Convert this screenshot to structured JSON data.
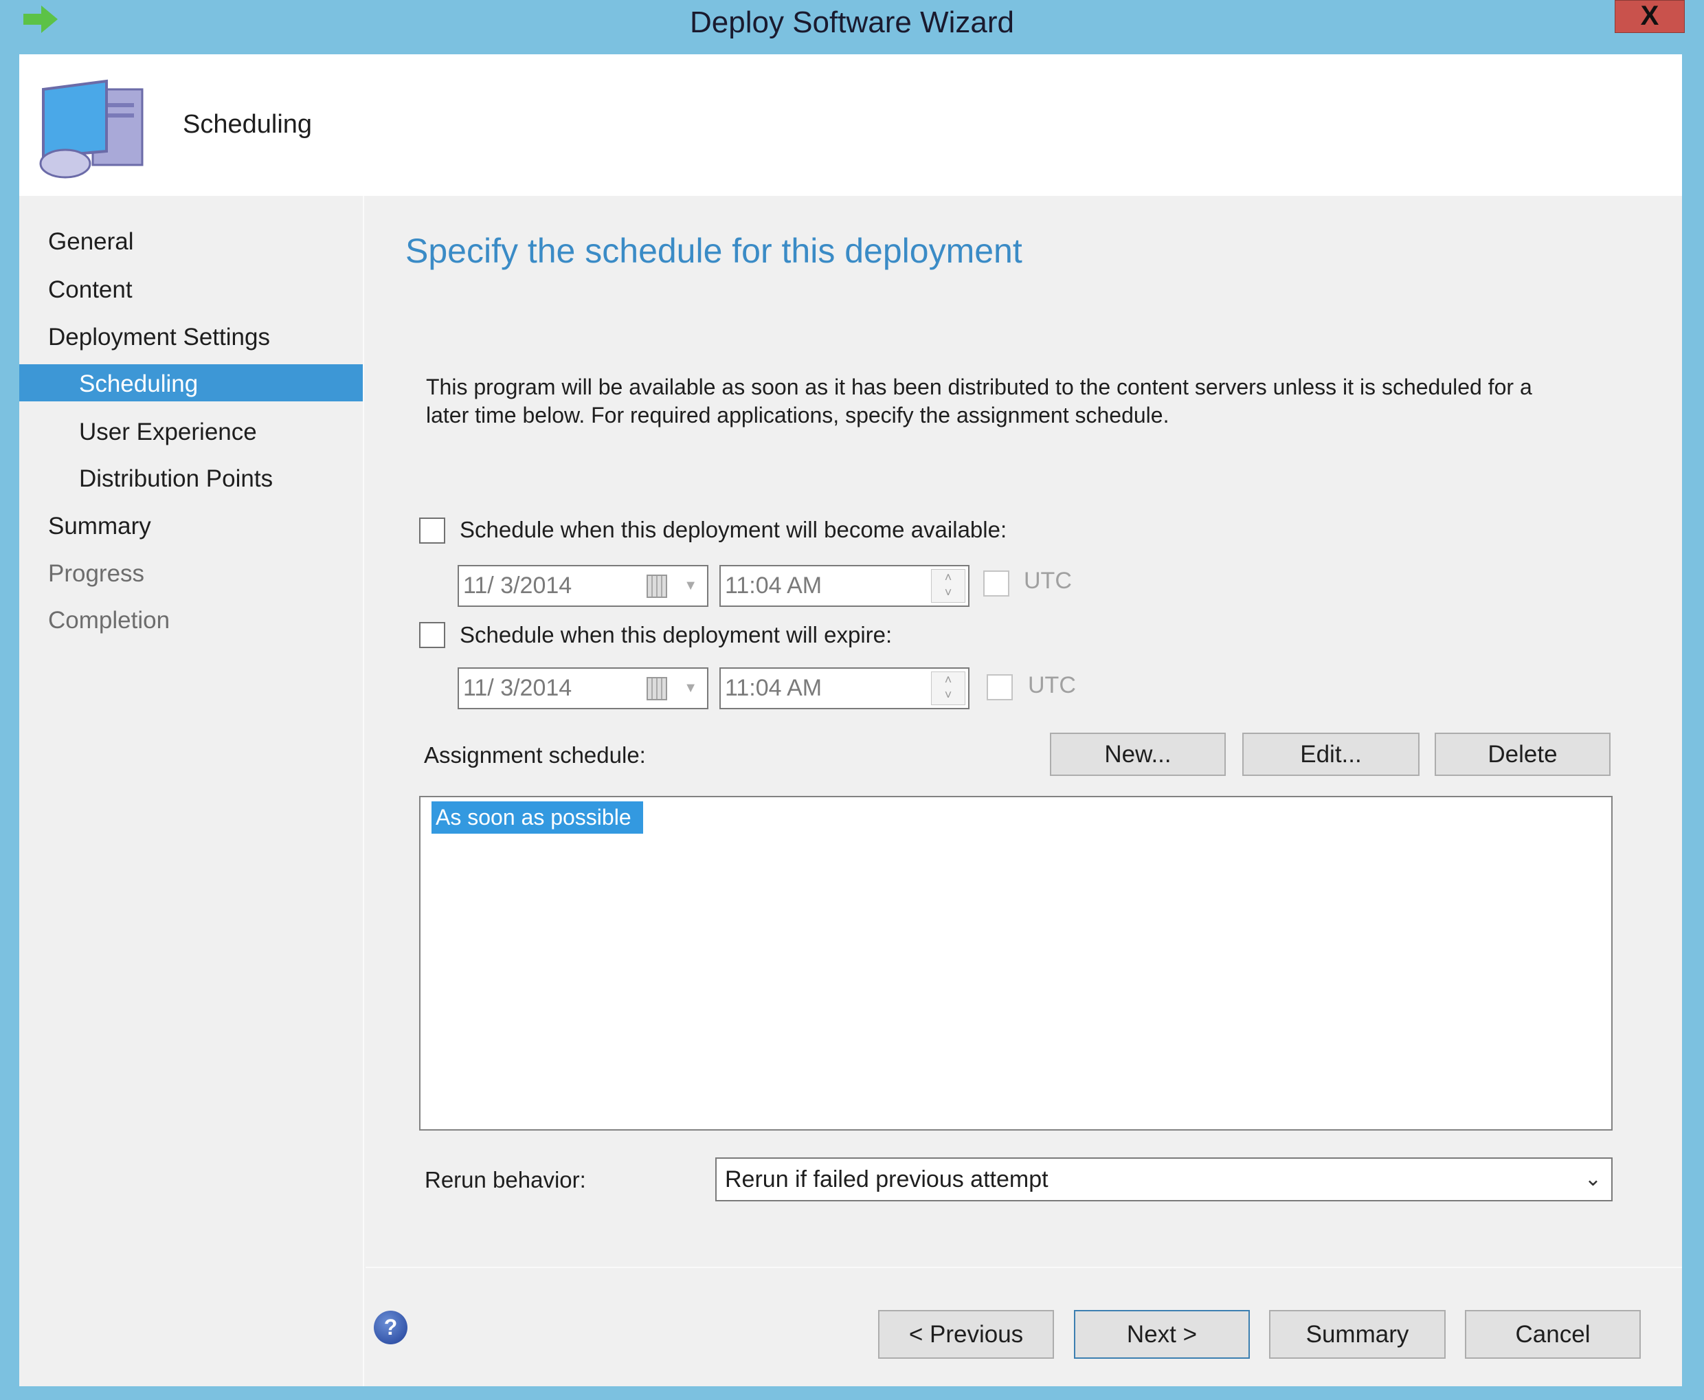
{
  "window": {
    "title": "Deploy Software Wizard",
    "close_label": "X"
  },
  "header": {
    "page_name": "Scheduling",
    "icon": "computer-icon"
  },
  "nav": {
    "items": [
      {
        "label": "General",
        "level": 0,
        "state": "normal"
      },
      {
        "label": "Content",
        "level": 0,
        "state": "normal"
      },
      {
        "label": "Deployment Settings",
        "level": 0,
        "state": "normal"
      },
      {
        "label": "Scheduling",
        "level": 1,
        "state": "selected"
      },
      {
        "label": "User Experience",
        "level": 1,
        "state": "normal"
      },
      {
        "label": "Distribution Points",
        "level": 1,
        "state": "normal"
      },
      {
        "label": "Summary",
        "level": 0,
        "state": "normal"
      },
      {
        "label": "Progress",
        "level": 0,
        "state": "disabled"
      },
      {
        "label": "Completion",
        "level": 0,
        "state": "disabled"
      }
    ]
  },
  "main": {
    "heading": "Specify the schedule for this deployment",
    "description": [
      "This program will be available as soon as it has been distributed to the content servers unless it is scheduled for a",
      "later time below. For required applications, specify the assignment schedule."
    ],
    "available": {
      "label": "Schedule when this deployment will become available:",
      "checked": false,
      "date": "11/  3/2014",
      "time": "11:04 AM",
      "utc_label": "UTC",
      "utc_checked": false
    },
    "expire": {
      "label": "Schedule when this deployment will expire:",
      "checked": false,
      "date": "11/  3/2014",
      "time": "11:04 AM",
      "utc_label": "UTC",
      "utc_checked": false
    },
    "assignment": {
      "label": "Assignment schedule:",
      "new_label": "New...",
      "edit_label": "Edit...",
      "delete_label": "Delete",
      "items": [
        "As soon as possible"
      ]
    },
    "rerun": {
      "label": "Rerun behavior:",
      "value": "Rerun if failed previous attempt"
    }
  },
  "footer": {
    "previous_label": "< Previous",
    "next_label": "Next >",
    "summary_label": "Summary",
    "cancel_label": "Cancel"
  },
  "colors": {
    "titlebar": "#7cc1e0",
    "accent": "#3d97d6",
    "heading": "#3a8bc6",
    "close": "#c9524c"
  }
}
